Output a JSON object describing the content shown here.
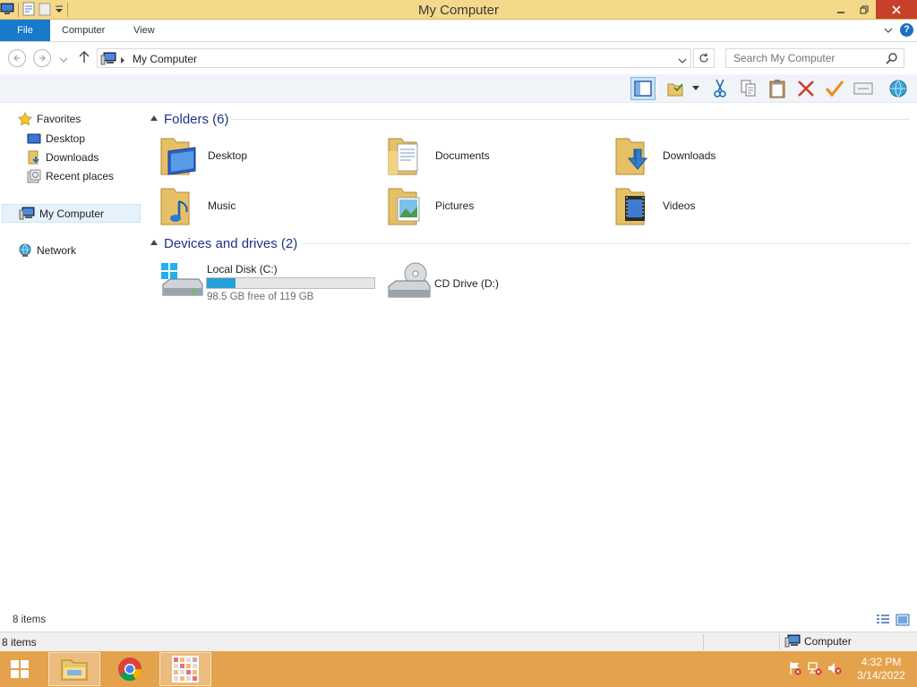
{
  "window": {
    "title": "My Computer"
  },
  "ribbon": {
    "tabs": [
      "File",
      "Computer",
      "View"
    ]
  },
  "address": {
    "path": "My Computer",
    "search_placeholder": "Search My Computer"
  },
  "nav": {
    "favorites": "Favorites",
    "favorite_items": [
      "Desktop",
      "Downloads",
      "Recent places"
    ],
    "my_computer": "My Computer",
    "network": "Network"
  },
  "content": {
    "folders_header": "Folders (6)",
    "folders": [
      "Desktop",
      "Documents",
      "Downloads",
      "Music",
      "Pictures",
      "Videos"
    ],
    "devices_header": "Devices and drives (2)",
    "drives": [
      {
        "name": "Local Disk (C:)",
        "free_text": "98.5 GB free of 119 GB",
        "used_fraction": 0.17
      },
      {
        "name": "CD Drive (D:)"
      }
    ]
  },
  "status": {
    "item_count": "8 items",
    "location": "Computer"
  },
  "taskbar": {
    "time": "4:32 PM",
    "date": "3/14/2022"
  },
  "colors": {
    "title_bar": "#f4d98a",
    "taskbar": "#e4a24c",
    "file_tab": "#1979ca",
    "progress": "#26a0da"
  }
}
